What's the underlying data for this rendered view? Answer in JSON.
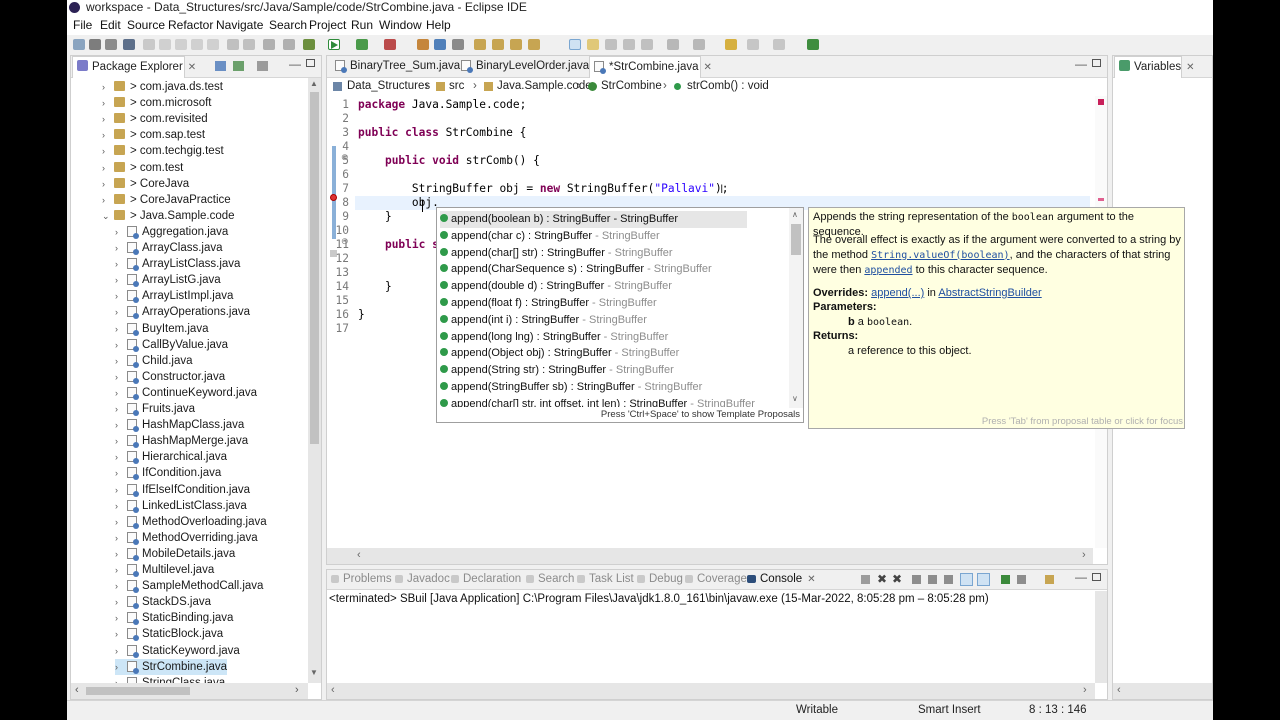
{
  "window": {
    "title": "workspace - Data_Structures/src/Java/Sample/code/StrCombine.java - Eclipse IDE"
  },
  "menu": [
    "File",
    "Edit",
    "Source",
    "Refactor",
    "Navigate",
    "Search",
    "Project",
    "Run",
    "Window",
    "Help"
  ],
  "explorer": {
    "tab_label": "Package Explorer",
    "items": [
      {
        "label": "> com.java.ds.test",
        "kind": "pkg",
        "arrow": "›"
      },
      {
        "label": "> com.microsoft",
        "kind": "pkg",
        "arrow": "›"
      },
      {
        "label": "> com.revisited",
        "kind": "pkg",
        "arrow": "›"
      },
      {
        "label": "> com.sap.test",
        "kind": "pkg",
        "arrow": "›"
      },
      {
        "label": "> com.techgig.test",
        "kind": "pkg",
        "arrow": "›"
      },
      {
        "label": "> com.test",
        "kind": "pkg",
        "arrow": "›"
      },
      {
        "label": "> CoreJava",
        "kind": "pkg",
        "arrow": "›"
      },
      {
        "label": "> CoreJavaPractice",
        "kind": "pkg",
        "arrow": "›"
      },
      {
        "label": "> Java.Sample.code",
        "kind": "pkg",
        "arrow": "⌄"
      },
      {
        "label": "Aggregation.java",
        "kind": "file",
        "arrow": "›"
      },
      {
        "label": "ArrayClass.java",
        "kind": "file",
        "arrow": "›"
      },
      {
        "label": "ArrayListClass.java",
        "kind": "file",
        "arrow": "›"
      },
      {
        "label": "ArrayListG.java",
        "kind": "file",
        "arrow": "›"
      },
      {
        "label": "ArrayListImpl.java",
        "kind": "file",
        "arrow": "›"
      },
      {
        "label": "ArrayOperations.java",
        "kind": "file",
        "arrow": "›"
      },
      {
        "label": "BuyItem.java",
        "kind": "file",
        "arrow": "›"
      },
      {
        "label": "CallByValue.java",
        "kind": "file",
        "arrow": "›"
      },
      {
        "label": "Child.java",
        "kind": "file",
        "arrow": "›"
      },
      {
        "label": "Constructor.java",
        "kind": "file",
        "arrow": "›"
      },
      {
        "label": "ContinueKeyword.java",
        "kind": "file",
        "arrow": "›"
      },
      {
        "label": "Fruits.java",
        "kind": "file",
        "arrow": "›"
      },
      {
        "label": "HashMapClass.java",
        "kind": "file",
        "arrow": "›"
      },
      {
        "label": "HashMapMerge.java",
        "kind": "file",
        "arrow": "›"
      },
      {
        "label": "Hierarchical.java",
        "kind": "file",
        "arrow": "›"
      },
      {
        "label": "IfCondition.java",
        "kind": "file",
        "arrow": "›"
      },
      {
        "label": "IfElseIfCondition.java",
        "kind": "file",
        "arrow": "›"
      },
      {
        "label": "LinkedListClass.java",
        "kind": "file",
        "arrow": "›"
      },
      {
        "label": "MethodOverloading.java",
        "kind": "file",
        "arrow": "›"
      },
      {
        "label": "MethodOverriding.java",
        "kind": "file",
        "arrow": "›"
      },
      {
        "label": "MobileDetails.java",
        "kind": "file",
        "arrow": "›"
      },
      {
        "label": "Multilevel.java",
        "kind": "file",
        "arrow": "›"
      },
      {
        "label": "SampleMethodCall.java",
        "kind": "file",
        "arrow": "›"
      },
      {
        "label": "StackDS.java",
        "kind": "file",
        "arrow": "›"
      },
      {
        "label": "StaticBinding.java",
        "kind": "file",
        "arrow": "›"
      },
      {
        "label": "StaticBlock.java",
        "kind": "file",
        "arrow": "›"
      },
      {
        "label": "StaticKeyword.java",
        "kind": "file",
        "arrow": "›"
      },
      {
        "label": "StrCombine.java",
        "kind": "file",
        "arrow": "›",
        "selected": true
      },
      {
        "label": "StringClass.java",
        "kind": "file",
        "arrow": "›"
      }
    ]
  },
  "editor": {
    "tabs": [
      {
        "label": "BinaryTree_Sum.java"
      },
      {
        "label": "BinaryLevelOrder.java"
      },
      {
        "label": "*StrCombine.java",
        "active": true
      }
    ],
    "breadcrumb": [
      "Data_Structures",
      "src",
      "Java.Sample.code",
      "StrCombine",
      "strComb() : void"
    ],
    "lines": [
      {
        "n": "1",
        "tokens": [
          {
            "t": "package ",
            "c": "kw"
          },
          {
            "t": "Java.Sample.code;"
          }
        ]
      },
      {
        "n": "2",
        "tokens": []
      },
      {
        "n": "3",
        "tokens": [
          {
            "t": "public class ",
            "c": "kw"
          },
          {
            "t": "StrCombine {"
          }
        ]
      },
      {
        "n": "4",
        "tokens": []
      },
      {
        "n": "5",
        "tokens": [
          {
            "t": "    "
          },
          {
            "t": "public void ",
            "c": "kw"
          },
          {
            "t": "strComb() {"
          }
        ]
      },
      {
        "n": "6",
        "tokens": []
      },
      {
        "n": "7",
        "tokens": [
          {
            "t": "        StringBuffer obj = "
          },
          {
            "t": "new ",
            "c": "kw"
          },
          {
            "t": "StringBuffer("
          },
          {
            "t": "\"Pallavi\"",
            "c": "str"
          },
          {
            "t": ");"
          }
        ]
      },
      {
        "n": "8",
        "tokens": [
          {
            "t": "        obj."
          }
        ]
      },
      {
        "n": "9",
        "tokens": [
          {
            "t": "    }"
          }
        ]
      },
      {
        "n": "10",
        "tokens": []
      },
      {
        "n": "11",
        "tokens": [
          {
            "t": "    "
          },
          {
            "t": "public st",
            "c": "kw"
          }
        ]
      },
      {
        "n": "12",
        "tokens": []
      },
      {
        "n": "13",
        "tokens": []
      },
      {
        "n": "14",
        "tokens": [
          {
            "t": "    }"
          }
        ]
      },
      {
        "n": "15",
        "tokens": []
      },
      {
        "n": "16",
        "tokens": [
          {
            "t": "}"
          }
        ]
      },
      {
        "n": "17",
        "tokens": []
      }
    ]
  },
  "completion": {
    "items": [
      {
        "sig": "append(boolean b) : StringBuffer - StringBuffer",
        "ret": "",
        "selected": true
      },
      {
        "sig": "append(char c) : StringBuffer",
        "ret": " - StringBuffer"
      },
      {
        "sig": "append(char[] str) : StringBuffer",
        "ret": " - StringBuffer"
      },
      {
        "sig": "append(CharSequence s) : StringBuffer",
        "ret": " - StringBuffer"
      },
      {
        "sig": "append(double d) : StringBuffer",
        "ret": " - StringBuffer"
      },
      {
        "sig": "append(float f) : StringBuffer",
        "ret": " - StringBuffer"
      },
      {
        "sig": "append(int i) : StringBuffer",
        "ret": " - StringBuffer"
      },
      {
        "sig": "append(long lng) : StringBuffer",
        "ret": " - StringBuffer"
      },
      {
        "sig": "append(Object obj) : StringBuffer",
        "ret": " - StringBuffer"
      },
      {
        "sig": "append(String str) : StringBuffer",
        "ret": " - StringBuffer"
      },
      {
        "sig": "append(StringBuffer sb) : StringBuffer",
        "ret": " - StringBuffer"
      },
      {
        "sig": "append(char[] str, int offset, int len) : StringBuffer",
        "ret": " - StringBuffer"
      }
    ],
    "hint": "Press 'Ctrl+Space' to show Template Proposals"
  },
  "javadoc": {
    "line1_pre": "Appends the string representation of the ",
    "line1_code": "boolean",
    "line1_post": " argument to the sequence.",
    "p2_a": "The overall effect is exactly as if the argument were converted to a string by the method ",
    "p2_code": "String.valueOf(boolean)",
    "p2_b": ", and the characters of that string were then ",
    "p2_link": "appended",
    "p2_c": " to this character sequence.",
    "overrides_label": "Overrides:",
    "overrides_link": "append(...)",
    "overrides_in": " in ",
    "overrides_class": "AbstractStringBuilder",
    "params_label": "Parameters:",
    "param_b": "b",
    "param_a": " a ",
    "param_code": "boolean",
    "param_end": ".",
    "returns_label": "Returns:",
    "returns_text": "a reference to this object.",
    "footer": "Press 'Tab' from proposal table or click for focus"
  },
  "right_panel": {
    "tab_label": "Variables"
  },
  "bottom": {
    "tabs": [
      "Problems",
      "Javadoc",
      "Declaration",
      "Search",
      "Task List",
      "Debug",
      "Coverage",
      "Console"
    ],
    "active": "Console",
    "console_text": "<terminated> SBuil [Java Application] C:\\Program Files\\Java\\jdk1.8.0_161\\bin\\javaw.exe  (15-Mar-2022, 8:05:28 pm – 8:05:28 pm)"
  },
  "status": {
    "writable": "Writable",
    "insert": "Smart Insert",
    "position": "8 : 13 : 146"
  }
}
